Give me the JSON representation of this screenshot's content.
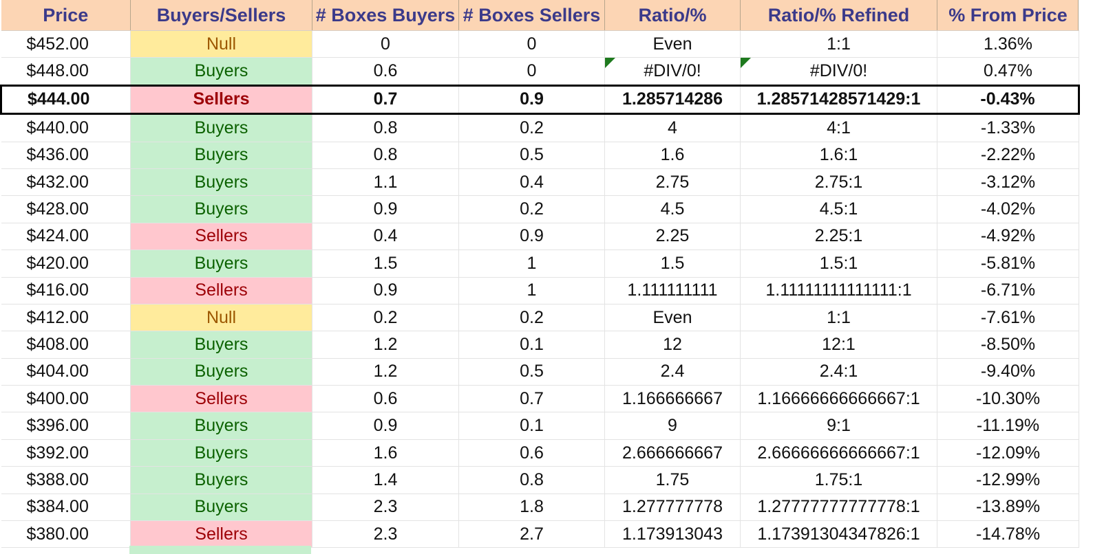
{
  "columns": [
    "Price",
    "Buyers/Sellers",
    "# Boxes Buyers",
    "# Boxes Sellers",
    "Ratio/%",
    "Ratio/% Refined",
    "% From Price"
  ],
  "colors": {
    "header_bg": "#fcd5b4",
    "header_text": "#3b3a8a",
    "buyers_bg": "#c6efce",
    "buyers_text": "#0b6100",
    "sellers_bg": "#ffc7ce",
    "sellers_text": "#9c0006",
    "null_bg": "#ffeb9c",
    "null_text": "#9c5700",
    "error_flag": "#1e7a1e"
  },
  "rows": [
    {
      "price": "$452.00",
      "side": "Null",
      "boxes_buyers": "0",
      "boxes_sellers": "0",
      "ratio": "Even",
      "ratio_refined": "1:1",
      "from_price": "1.36%"
    },
    {
      "price": "$448.00",
      "side": "Buyers",
      "boxes_buyers": "0.6",
      "boxes_sellers": "0",
      "ratio": "#DIV/0!",
      "ratio_refined": "#DIV/0!",
      "from_price": "0.47%",
      "error_flag": true
    },
    {
      "price": "$444.00",
      "side": "Sellers",
      "boxes_buyers": "0.7",
      "boxes_sellers": "0.9",
      "ratio": "1.285714286",
      "ratio_refined": "1.28571428571429:1",
      "from_price": "-0.43%",
      "current": true
    },
    {
      "price": "$440.00",
      "side": "Buyers",
      "boxes_buyers": "0.8",
      "boxes_sellers": "0.2",
      "ratio": "4",
      "ratio_refined": "4:1",
      "from_price": "-1.33%"
    },
    {
      "price": "$436.00",
      "side": "Buyers",
      "boxes_buyers": "0.8",
      "boxes_sellers": "0.5",
      "ratio": "1.6",
      "ratio_refined": "1.6:1",
      "from_price": "-2.22%"
    },
    {
      "price": "$432.00",
      "side": "Buyers",
      "boxes_buyers": "1.1",
      "boxes_sellers": "0.4",
      "ratio": "2.75",
      "ratio_refined": "2.75:1",
      "from_price": "-3.12%"
    },
    {
      "price": "$428.00",
      "side": "Buyers",
      "boxes_buyers": "0.9",
      "boxes_sellers": "0.2",
      "ratio": "4.5",
      "ratio_refined": "4.5:1",
      "from_price": "-4.02%"
    },
    {
      "price": "$424.00",
      "side": "Sellers",
      "boxes_buyers": "0.4",
      "boxes_sellers": "0.9",
      "ratio": "2.25",
      "ratio_refined": "2.25:1",
      "from_price": "-4.92%"
    },
    {
      "price": "$420.00",
      "side": "Buyers",
      "boxes_buyers": "1.5",
      "boxes_sellers": "1",
      "ratio": "1.5",
      "ratio_refined": "1.5:1",
      "from_price": "-5.81%"
    },
    {
      "price": "$416.00",
      "side": "Sellers",
      "boxes_buyers": "0.9",
      "boxes_sellers": "1",
      "ratio": "1.111111111",
      "ratio_refined": "1.11111111111111:1",
      "from_price": "-6.71%"
    },
    {
      "price": "$412.00",
      "side": "Null",
      "boxes_buyers": "0.2",
      "boxes_sellers": "0.2",
      "ratio": "Even",
      "ratio_refined": "1:1",
      "from_price": "-7.61%"
    },
    {
      "price": "$408.00",
      "side": "Buyers",
      "boxes_buyers": "1.2",
      "boxes_sellers": "0.1",
      "ratio": "12",
      "ratio_refined": "12:1",
      "from_price": "-8.50%"
    },
    {
      "price": "$404.00",
      "side": "Buyers",
      "boxes_buyers": "1.2",
      "boxes_sellers": "0.5",
      "ratio": "2.4",
      "ratio_refined": "2.4:1",
      "from_price": "-9.40%"
    },
    {
      "price": "$400.00",
      "side": "Sellers",
      "boxes_buyers": "0.6",
      "boxes_sellers": "0.7",
      "ratio": "1.166666667",
      "ratio_refined": "1.16666666666667:1",
      "from_price": "-10.30%"
    },
    {
      "price": "$396.00",
      "side": "Buyers",
      "boxes_buyers": "0.9",
      "boxes_sellers": "0.1",
      "ratio": "9",
      "ratio_refined": "9:1",
      "from_price": "-11.19%"
    },
    {
      "price": "$392.00",
      "side": "Buyers",
      "boxes_buyers": "1.6",
      "boxes_sellers": "0.6",
      "ratio": "2.666666667",
      "ratio_refined": "2.66666666666667:1",
      "from_price": "-12.09%"
    },
    {
      "price": "$388.00",
      "side": "Buyers",
      "boxes_buyers": "1.4",
      "boxes_sellers": "0.8",
      "ratio": "1.75",
      "ratio_refined": "1.75:1",
      "from_price": "-12.99%"
    },
    {
      "price": "$384.00",
      "side": "Buyers",
      "boxes_buyers": "2.3",
      "boxes_sellers": "1.8",
      "ratio": "1.277777778",
      "ratio_refined": "1.27777777777778:1",
      "from_price": "-13.89%"
    },
    {
      "price": "$380.00",
      "side": "Sellers",
      "boxes_buyers": "2.3",
      "boxes_sellers": "2.7",
      "ratio": "1.173913043",
      "ratio_refined": "1.17391304347826:1",
      "from_price": "-14.78%"
    }
  ]
}
